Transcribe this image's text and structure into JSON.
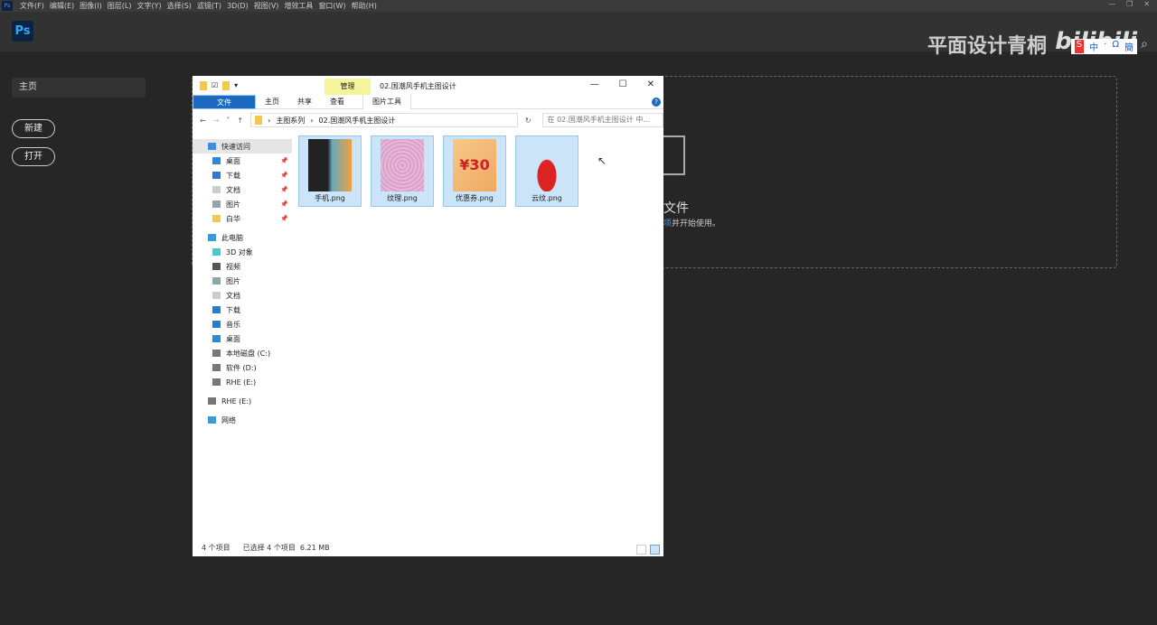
{
  "ps": {
    "menu": [
      "文件(F)",
      "编辑(E)",
      "图像(I)",
      "图层(L)",
      "文字(Y)",
      "选择(S)",
      "滤镜(T)",
      "3D(D)",
      "视图(V)",
      "增效工具",
      "窗口(W)",
      "帮助(H)"
    ],
    "logo": "Ps",
    "home": "主页",
    "new": "新建",
    "open": "打开",
    "dz_title": "文件",
    "dz_sub_link": "项",
    "dz_sub": "并开始使用。"
  },
  "overlay": {
    "watermark": "平面设计青桐",
    "bili": "bilibili",
    "ime": [
      "中",
      "·",
      "Ω",
      "簡"
    ]
  },
  "explorer": {
    "manage": "管理",
    "title": "02.国潮风手机主图设计",
    "tabs": {
      "file": "文件",
      "home": "主页",
      "share": "共享",
      "view": "查看",
      "picture_tools": "图片工具"
    },
    "breadcrumb": [
      "主图系列",
      "02.国潮风手机主图设计"
    ],
    "search_placeholder": "在 02.国潮风手机主图设计 中...",
    "nav": [
      {
        "label": "快速访问",
        "icon": "star-icon",
        "level": 0,
        "pin": false
      },
      {
        "label": "桌面",
        "icon": "desktop-icon",
        "level": 1,
        "pin": true
      },
      {
        "label": "下载",
        "icon": "download-icon",
        "level": 1,
        "pin": true
      },
      {
        "label": "文档",
        "icon": "document-icon",
        "level": 1,
        "pin": true
      },
      {
        "label": "图片",
        "icon": "pictures-icon",
        "level": 1,
        "pin": true
      },
      {
        "label": "白华",
        "icon": "folder-icon",
        "level": 1,
        "pin": true
      },
      {
        "label": "此电脑",
        "icon": "computer-icon",
        "level": 0,
        "pin": false
      },
      {
        "label": "3D 对象",
        "icon": "3d-icon",
        "level": 1,
        "pin": false
      },
      {
        "label": "视频",
        "icon": "video-icon",
        "level": 1,
        "pin": false
      },
      {
        "label": "图片",
        "icon": "pictures-icon",
        "level": 1,
        "pin": false
      },
      {
        "label": "文档",
        "icon": "document-icon",
        "level": 1,
        "pin": false
      },
      {
        "label": "下载",
        "icon": "download-icon",
        "level": 1,
        "pin": false
      },
      {
        "label": "音乐",
        "icon": "music-icon",
        "level": 1,
        "pin": false
      },
      {
        "label": "桌面",
        "icon": "desktop-icon",
        "level": 1,
        "pin": false
      },
      {
        "label": "本地磁盘 (C:)",
        "icon": "drive-icon",
        "level": 1,
        "pin": false
      },
      {
        "label": "软件 (D:)",
        "icon": "drive-icon",
        "level": 1,
        "pin": false
      },
      {
        "label": "RHE (E:)",
        "icon": "drive-icon",
        "level": 1,
        "pin": false
      },
      {
        "label": "RHE (E:)",
        "icon": "drive-icon",
        "level": 0,
        "pin": false
      },
      {
        "label": "网络",
        "icon": "network-icon",
        "level": 0,
        "pin": false
      }
    ],
    "files": [
      {
        "name": "手机.png",
        "thumb": "phone"
      },
      {
        "name": "纹理.png",
        "thumb": "texture"
      },
      {
        "name": "优惠券.png",
        "thumb": "coupon",
        "text": "¥30"
      },
      {
        "name": "云纹.png",
        "thumb": "cloud"
      }
    ],
    "status": {
      "count": "4 个项目",
      "selected": "已选择 4 个项目",
      "size": "6.21 MB"
    }
  }
}
